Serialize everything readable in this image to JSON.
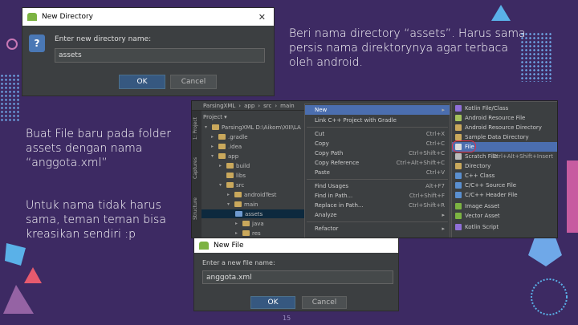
{
  "slide": {
    "text_top": "Beri nama directory “assets”. Harus sama persis nama direktorynya agar terbaca oleh android.",
    "text_left_1": "Buat File baru pada folder assets dengan nama “anggota.xml”",
    "text_left_2": "Untuk nama tidak harus sama, teman teman bisa kreasikan sendiri :p",
    "page_number": "15"
  },
  "new_directory_dialog": {
    "title": "New Directory",
    "close_icon": "close-icon",
    "prompt": "Enter new directory name:",
    "value": "assets",
    "ok_label": "OK",
    "cancel_label": "Cancel"
  },
  "ide": {
    "breadcrumb": [
      "ParsingXML",
      "app",
      "src",
      "main"
    ],
    "side_tabs": [
      "1: Project",
      "Captures",
      "Structure"
    ],
    "tree": [
      {
        "label": "Project ▾"
      },
      {
        "label": "ParsingXML  D:\\Aikom\\XIII\\LA"
      },
      {
        "label": ".gradle"
      },
      {
        "label": ".idea"
      },
      {
        "label": "app"
      },
      {
        "label": "build"
      },
      {
        "label": "libs"
      },
      {
        "label": "src"
      },
      {
        "label": "androidTest"
      },
      {
        "label": "main"
      },
      {
        "label": "assets"
      },
      {
        "label": "java"
      },
      {
        "label": "res"
      }
    ],
    "context_menu": [
      {
        "label": "New",
        "key": "▸"
      },
      {
        "label": "Link C++ Project with Gradle",
        "key": ""
      },
      {
        "label": "Cut",
        "key": "Ctrl+X"
      },
      {
        "label": "Copy",
        "key": "Ctrl+C"
      },
      {
        "label": "Copy Path",
        "key": "Ctrl+Shift+C"
      },
      {
        "label": "Copy Reference",
        "key": "Ctrl+Alt+Shift+C"
      },
      {
        "label": "Paste",
        "key": "Ctrl+V"
      },
      {
        "label": "Find Usages",
        "key": "Alt+F7"
      },
      {
        "label": "Find in Path...",
        "key": "Ctrl+Shift+F"
      },
      {
        "label": "Replace in Path...",
        "key": "Ctrl+Shift+R"
      },
      {
        "label": "Analyze",
        "key": "▸"
      },
      {
        "label": "Refactor",
        "key": "▸"
      }
    ],
    "submenu": [
      {
        "label": "Kotlin File/Class",
        "key": ""
      },
      {
        "label": "Android Resource File",
        "key": ""
      },
      {
        "label": "Android Resource Directory",
        "key": ""
      },
      {
        "label": "Sample Data Directory",
        "key": ""
      },
      {
        "label": "File",
        "key": ""
      },
      {
        "label": "Scratch File",
        "key": "Ctrl+Alt+Shift+Insert"
      },
      {
        "label": "Directory",
        "key": ""
      },
      {
        "label": "C++ Class",
        "key": ""
      },
      {
        "label": "C/C++ Source File",
        "key": ""
      },
      {
        "label": "C/C++ Header File",
        "key": ""
      },
      {
        "label": "Image Asset",
        "key": ""
      },
      {
        "label": "Vector Asset",
        "key": ""
      },
      {
        "label": "Kotlin Script",
        "key": ""
      }
    ]
  },
  "new_file_dialog": {
    "title": "New File",
    "prompt": "Enter a new file name:",
    "value": "anggota.xml",
    "ok_label": "OK",
    "cancel_label": "Cancel"
  },
  "colors": {
    "background": "#3d2a63",
    "highlight": "#4b6eaf",
    "annotation_circle": "#e0304a"
  }
}
